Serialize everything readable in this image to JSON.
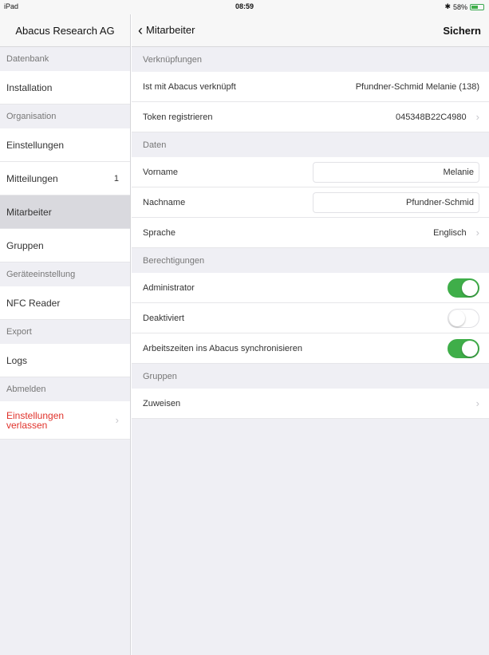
{
  "statusbar": {
    "device": "iPad",
    "time": "08:59",
    "battery": "58%",
    "battery_level": 0.58
  },
  "sidebar": {
    "title": "Abacus Research AG",
    "sections": {
      "datenbank": "Datenbank",
      "organisation": "Organisation",
      "geraete": "Geräteeinstellung",
      "export": "Export",
      "abmelden": "Abmelden"
    },
    "items": {
      "installation": "Installation",
      "einstellungen": "Einstellungen",
      "mitteilungen": "Mitteilungen",
      "mitteilungen_count": "1",
      "mitarbeiter": "Mitarbeiter",
      "gruppen": "Gruppen",
      "nfc": "NFC Reader",
      "logs": "Logs",
      "exit_line1": "Einstellungen",
      "exit_line2": "verlassen"
    }
  },
  "nav": {
    "back_label": "Mitarbeiter",
    "save_label": "Sichern"
  },
  "main": {
    "sections": {
      "verknuepfungen": "Verknüpfungen",
      "daten": "Daten",
      "berechtigungen": "Berechtigungen",
      "gruppen": "Gruppen"
    },
    "rows": {
      "linked_label": "Ist mit Abacus verknüpft",
      "linked_value": "Pfundner-Schmid Melanie (138)",
      "token_label": "Token registrieren",
      "token_value": "045348B22C4980",
      "vorname_label": "Vorname",
      "vorname_value": "Melanie",
      "nachname_label": "Nachname",
      "nachname_value": "Pfundner-Schmid",
      "sprache_label": "Sprache",
      "sprache_value": "Englisch",
      "admin_label": "Administrator",
      "admin_on": true,
      "deaktiviert_label": "Deaktiviert",
      "deaktiviert_on": false,
      "sync_label": "Arbeitszeiten ins Abacus synchronisieren",
      "sync_on": true,
      "zuweisen_label": "Zuweisen"
    }
  },
  "colors": {
    "toggle_on": "#3fae49",
    "exit_text": "#e0322b"
  }
}
